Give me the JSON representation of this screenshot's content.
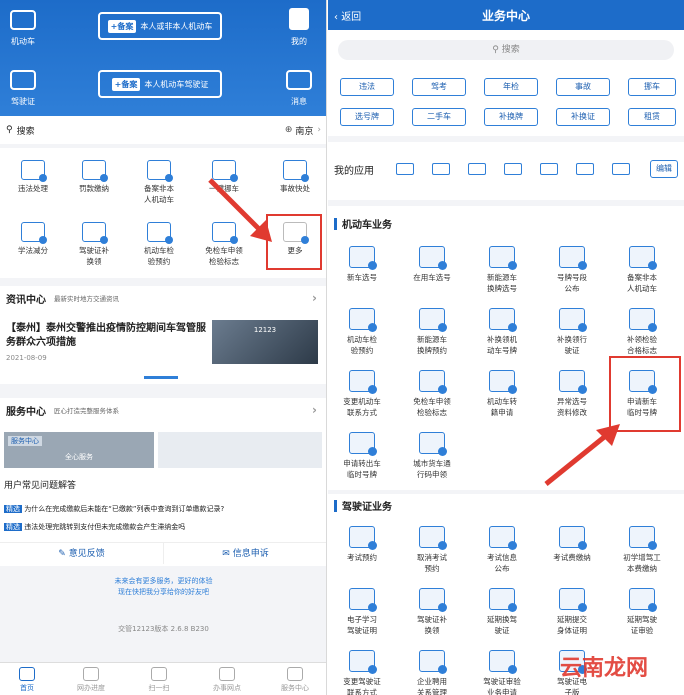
{
  "left": {
    "header": {
      "top_left": "机动车",
      "top_pill_tag": "+备案",
      "top_pill_text": "本人或非本人机动车",
      "mine": "我的",
      "bottom_left": "驾驶证",
      "bottom_pill_tag": "+备案",
      "bottom_pill_text": "本人机动车驾驶证",
      "msg": "消息"
    },
    "search": {
      "label": "搜索",
      "city": "南京"
    },
    "grid": [
      "违法处理",
      "罚款缴纳",
      "备案非本\n人机动车",
      "一键挪车",
      "事故快处",
      "学法减分",
      "驾驶证补\n换领",
      "机动车检\n验预约",
      "免检车申领\n检验标志",
      "更多"
    ],
    "news": {
      "title": "资讯中心",
      "sub": "最新实时地方交通资讯",
      "headline": "【泰州】泰州交警推出疫情防控期间车驾管服务群众六项措施",
      "date": "2021-08-09",
      "thumb": "12123"
    },
    "service": {
      "title": "服务中心",
      "sub": "匠心打造完整服务体系",
      "banner_tag": "服务中心",
      "banner": "全心服务",
      "faq_title": "用户常见问题解答",
      "q1": "为什么在完成缴款后未能在“已缴款”列表中查询到订单缴款记录?",
      "q2": "违法处理完跳转到支付但未完成缴款会产生滞纳金吗",
      "badge": "精选",
      "feedback": "意见反馈",
      "complaint": "信息申诉"
    },
    "footer": {
      "line1": "未来会有更多服务，更好的体验",
      "line2": "现在快把我分享给你的好友吧",
      "version": "交管12123版本 2.6.8 B230"
    },
    "tabs": [
      "首页",
      "网办进度",
      "扫一扫",
      "办事网点",
      "服务中心"
    ]
  },
  "right": {
    "back": "返回",
    "title": "业务中心",
    "search": "搜索",
    "buttons": [
      "违法",
      "驾考",
      "年检",
      "事故",
      "挪车",
      "选号牌",
      "二手车",
      "补换牌",
      "补换证",
      "租赁"
    ],
    "myapps": "我的应用",
    "edit": "编辑",
    "sec1": "机动车业务",
    "vehicle": [
      "新车选号",
      "在用车选号",
      "新能源车\n换牌选号",
      "号牌号段\n公布",
      "备案非本\n人机动车",
      "机动车检\n验预约",
      "新能源车\n换牌预约",
      "补换领机\n动车号牌",
      "补换领行\n驶证",
      "补领检验\n合格标志",
      "变更机动车\n联系方式",
      "免检车申领\n检验标志",
      "机动车转\n籍申请",
      "异常选号\n资料修改",
      "申请新车\n临时号牌",
      "申请转出车\n临时号牌",
      "城市货车通\n行码申领"
    ],
    "sec2": "驾驶证业务",
    "license": [
      "考试预约",
      "取消考试\n预约",
      "考试信息\n公布",
      "考试费缴纳",
      "初学增驾工\n本费缴纳",
      "电子学习\n驾驶证明",
      "驾驶证补\n换领",
      "延期换驾\n驶证",
      "延期提交\n身体证明",
      "延期驾驶\n证审验",
      "变更驾驶证\n联系方式",
      "企业聘用\n关系管理",
      "驾驶证审验\n业务申请",
      "驾驶证电\n子版"
    ],
    "watermark": "云南龙网"
  },
  "colors": {
    "brand": "#1d6cc9",
    "highlight": "#e03a30"
  }
}
